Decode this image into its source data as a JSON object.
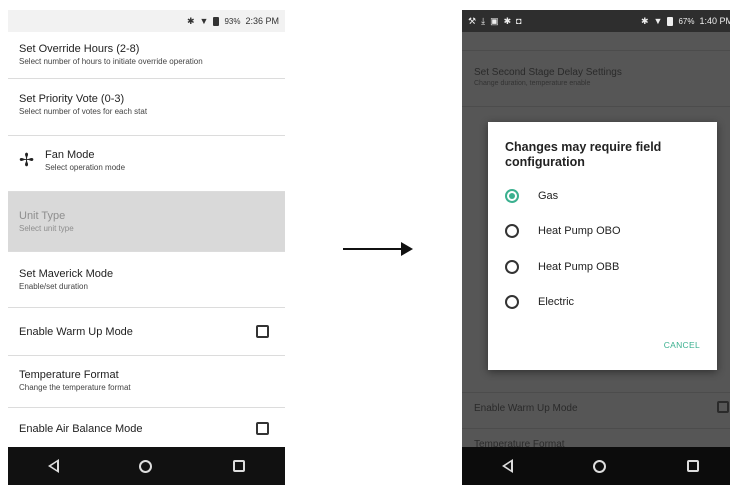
{
  "left_screen": {
    "status_bar": {
      "icons": [
        "bluetooth-icon",
        "wifi-icon",
        "battery-icon"
      ],
      "battery": "93%",
      "time": "2:36 PM"
    },
    "items": [
      {
        "title": "Set Override Hours (2-8)",
        "subtitle": "Select number of hours to initiate override operation"
      },
      {
        "title": "Set Priority Vote (0-3)",
        "subtitle": "Select number of votes for each stat"
      },
      {
        "title": "Fan Mode",
        "subtitle": "Select operation mode",
        "icon": "fan-icon"
      },
      {
        "title": "Unit Type",
        "subtitle": "Select unit type",
        "state": "disabled"
      },
      {
        "title": "Set Maverick Mode",
        "subtitle": "Enable/set duration"
      },
      {
        "title": "Enable Warm Up Mode",
        "checkbox": false
      },
      {
        "title": "Temperature Format",
        "subtitle": "Change the temperature format"
      },
      {
        "title": "Enable Air Balance Mode",
        "checkbox": false
      }
    ]
  },
  "right_screen": {
    "status_bar": {
      "left_icons": [
        "wrench-icon",
        "download-icon",
        "image-icon",
        "bluetooth-icon",
        "camera-icon"
      ],
      "battery": "67%",
      "time": "1:40 PM"
    },
    "background_items": [
      {
        "title": "Set Second Stage Delay Settings",
        "subtitle": "Change duration, temperature enable"
      },
      {
        "title": "Enable Warm Up Mode",
        "checkbox": false
      },
      {
        "title": "Temperature Format"
      }
    ],
    "dialog": {
      "title": "Changes may require field configuration",
      "options": [
        {
          "label": "Gas",
          "selected": true
        },
        {
          "label": "Heat Pump OBO",
          "selected": false
        },
        {
          "label": "Heat Pump OBB",
          "selected": false
        },
        {
          "label": "Electric",
          "selected": false
        }
      ],
      "cancel_label": "CANCEL"
    }
  },
  "navigation": {
    "buttons": [
      "back-icon",
      "home-icon",
      "recents-icon"
    ]
  },
  "colors": {
    "accent": "#3bb08f",
    "disabled_bg": "#d9d9d9",
    "navbar": "#111111",
    "scrim": "#565656"
  }
}
